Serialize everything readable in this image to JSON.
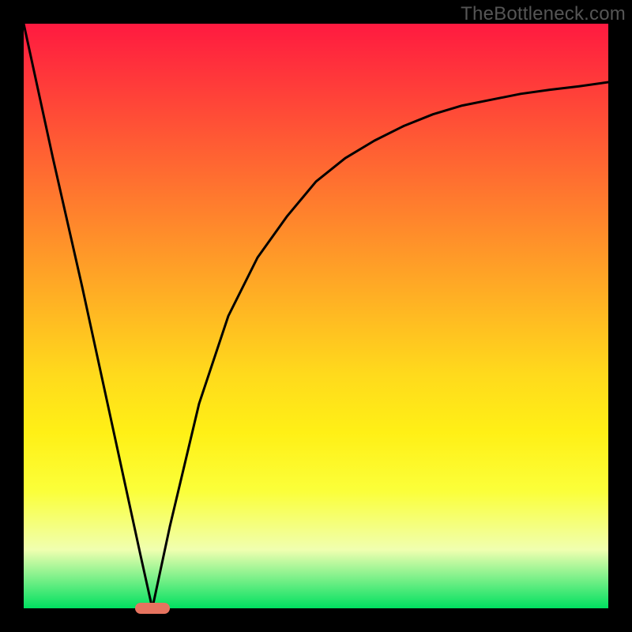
{
  "watermark": "TheBottleneck.com",
  "chart_data": {
    "type": "line",
    "title": "",
    "xlabel": "",
    "ylabel": "",
    "xlim": [
      0,
      100
    ],
    "ylim": [
      0,
      100
    ],
    "grid": false,
    "legend": false,
    "series": [
      {
        "name": "curve",
        "x": [
          0,
          5,
          10,
          15,
          20,
          22,
          25,
          30,
          35,
          40,
          45,
          50,
          55,
          60,
          65,
          70,
          75,
          80,
          85,
          90,
          95,
          100
        ],
        "values": [
          100,
          77,
          55,
          32,
          9,
          0,
          14,
          35,
          50,
          60,
          67,
          73,
          77,
          80,
          82.5,
          84.5,
          86,
          87,
          88,
          88.7,
          89.3,
          90
        ]
      }
    ],
    "marker": {
      "x": 22,
      "y": 0,
      "color": "#e6735f"
    },
    "background_gradient": {
      "top": "#ff1a40",
      "bottom": "#00e060"
    }
  }
}
